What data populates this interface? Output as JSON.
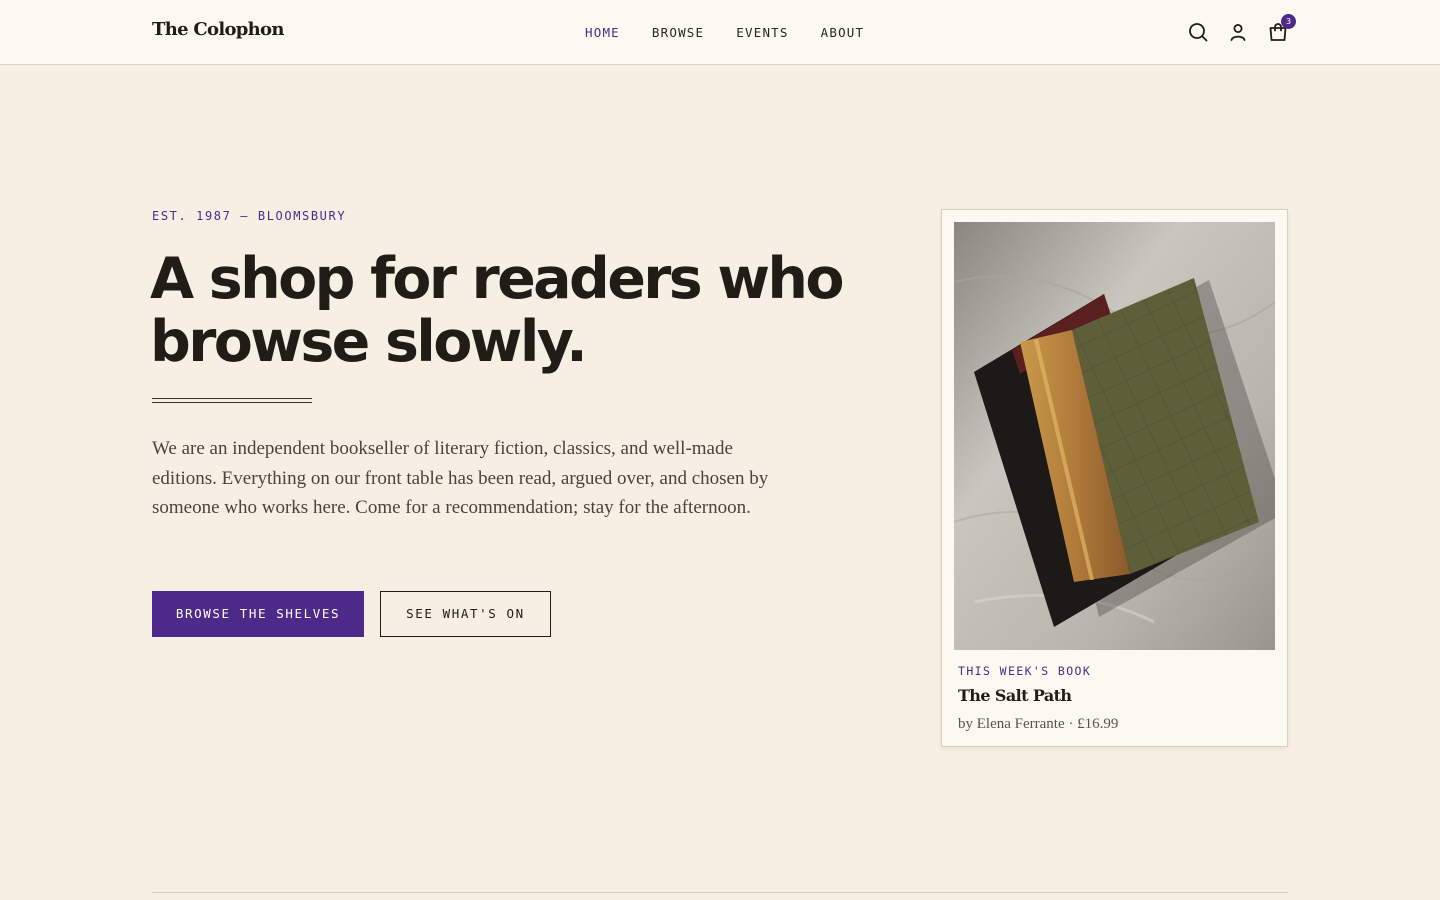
{
  "brand": {
    "name": "The Colophon"
  },
  "nav": {
    "items": [
      {
        "label": "HOME",
        "active": true
      },
      {
        "label": "BROWSE",
        "active": false
      },
      {
        "label": "EVENTS",
        "active": false
      },
      {
        "label": "ABOUT",
        "active": false
      }
    ]
  },
  "header_icons": {
    "search": "search-icon",
    "account": "user-icon",
    "cart": "shopping-bag-icon",
    "cart_count": "3"
  },
  "hero": {
    "eyebrow": "EST. 1987 — BLOOMSBURY",
    "headline": "A shop for readers who browse slowly.",
    "intro": "We are an independent bookseller of literary fiction, classics, and well-made editions. Everything on our front table has been read, argued over, and chosen by someone who works here. Come for a recommendation; stay for the afternoon.",
    "primary_cta": "BROWSE THE SHELVES",
    "secondary_cta": "SEE WHAT'S ON"
  },
  "featured": {
    "eyebrow": "THIS WEEK'S BOOK",
    "title": "The Salt Path",
    "author": "by Elena Ferrante",
    "separator": " · ",
    "price": "£16.99"
  },
  "colors": {
    "accent": "#4d2a8a",
    "background": "#f5efe4",
    "header_bg": "#fcf9f1",
    "text": "#221c17"
  }
}
